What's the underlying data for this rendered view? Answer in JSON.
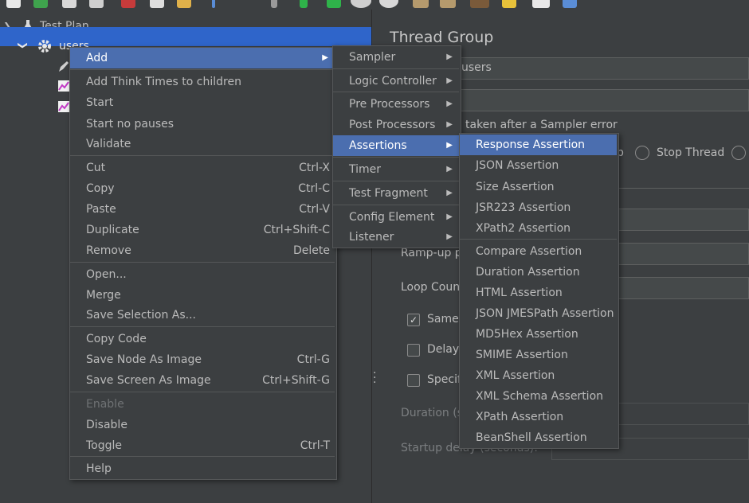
{
  "tree": {
    "root_label": "Test Plan",
    "thread_group_label": "users"
  },
  "panel": {
    "title": "Thread Group",
    "name_value": "users",
    "error_action_label": "taken after a Sampler error",
    "radio_partial": "p",
    "radio_stop_thread": "Stop Thread",
    "rampup_label": "Ramp-up p",
    "loop_label": "Loop Coun",
    "same_label": "Same",
    "delay_label": "Delay",
    "specify_label": "Specif",
    "duration_label": "Duration (s",
    "startup_label": "Startup delay (seconds):"
  },
  "context_menu": {
    "items": [
      {
        "label": "Add",
        "submenu": true,
        "selected": true
      },
      {
        "label": "Add Think Times to children"
      },
      {
        "label": "Start"
      },
      {
        "label": "Start no pauses"
      },
      {
        "label": "Validate"
      },
      {
        "label": "Cut",
        "shortcut": "Ctrl-X"
      },
      {
        "label": "Copy",
        "shortcut": "Ctrl-C"
      },
      {
        "label": "Paste",
        "shortcut": "Ctrl-V"
      },
      {
        "label": "Duplicate",
        "shortcut": "Ctrl+Shift-C"
      },
      {
        "label": "Remove",
        "shortcut": "Delete"
      },
      {
        "label": "Open..."
      },
      {
        "label": "Merge"
      },
      {
        "label": "Save Selection As..."
      },
      {
        "label": "Copy Code"
      },
      {
        "label": "Save Node As Image",
        "shortcut": "Ctrl-G"
      },
      {
        "label": "Save Screen As Image",
        "shortcut": "Ctrl+Shift-G"
      },
      {
        "label": "Enable",
        "disabled": true
      },
      {
        "label": "Disable"
      },
      {
        "label": "Toggle",
        "shortcut": "Ctrl-T"
      },
      {
        "label": "Help"
      }
    ]
  },
  "add_menu": {
    "items": [
      {
        "label": "Sampler"
      },
      {
        "label": "Logic Controller"
      },
      {
        "label": "Pre Processors"
      },
      {
        "label": "Post Processors"
      },
      {
        "label": "Assertions",
        "selected": true
      },
      {
        "label": "Timer"
      },
      {
        "label": "Test Fragment"
      },
      {
        "label": "Config Element"
      },
      {
        "label": "Listener"
      }
    ]
  },
  "assertions_menu": {
    "items": [
      {
        "label": "Response Assertion",
        "selected": true
      },
      {
        "label": "JSON Assertion"
      },
      {
        "label": "Size Assertion"
      },
      {
        "label": "JSR223 Assertion"
      },
      {
        "label": "XPath2 Assertion"
      },
      {
        "label": "Compare Assertion"
      },
      {
        "label": "Duration Assertion"
      },
      {
        "label": "HTML Assertion"
      },
      {
        "label": "JSON JMESPath Assertion"
      },
      {
        "label": "MD5Hex Assertion"
      },
      {
        "label": "SMIME Assertion"
      },
      {
        "label": "XML Assertion"
      },
      {
        "label": "XML Schema Assertion"
      },
      {
        "label": "XPath Assertion"
      },
      {
        "label": "BeanShell Assertion"
      }
    ]
  },
  "colors": {
    "background": "#3c3f41",
    "selection": "#4b6eaf",
    "tree_selection": "#2f65ca",
    "text": "#bbbbbb"
  }
}
